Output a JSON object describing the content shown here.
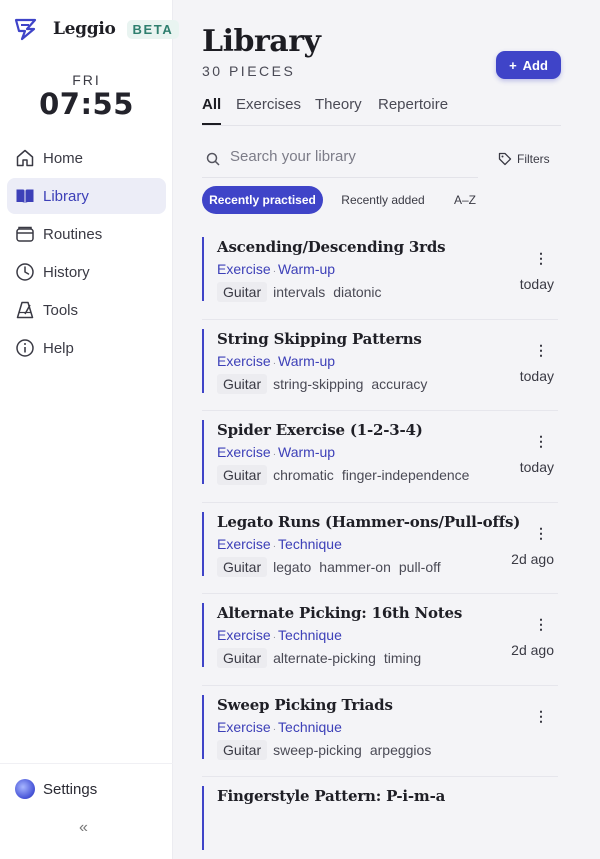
{
  "app": {
    "name": "Leggio",
    "badge": "BETA"
  },
  "clock": {
    "day": "FRI",
    "time": "07:55"
  },
  "nav": [
    {
      "label": "Home",
      "icon": "home-icon",
      "active": false
    },
    {
      "label": "Library",
      "icon": "book-icon",
      "active": true
    },
    {
      "label": "Routines",
      "icon": "folder-icon",
      "active": false
    },
    {
      "label": "History",
      "icon": "clock-icon",
      "active": false
    },
    {
      "label": "Tools",
      "icon": "metronome-icon",
      "active": false
    },
    {
      "label": "Help",
      "icon": "info-icon",
      "active": false
    }
  ],
  "settings": {
    "label": "Settings"
  },
  "library": {
    "title": "Library",
    "count": "30 PIECES",
    "add_label": "Add",
    "tabs": [
      "All",
      "Exercises",
      "Theory",
      "Repertoire"
    ],
    "search_placeholder": "Search your library",
    "filters_label": "Filters",
    "sort_options": [
      "Recently practised",
      "Recently added",
      "A–Z"
    ],
    "items": [
      {
        "title": "Ascending/Descending 3rds",
        "type": "Exercise",
        "category": "Warm-up",
        "instrument": "Guitar",
        "tags": [
          "intervals",
          "diatonic"
        ],
        "when": "today"
      },
      {
        "title": "String Skipping Patterns",
        "type": "Exercise",
        "category": "Warm-up",
        "instrument": "Guitar",
        "tags": [
          "string-skipping",
          "accuracy"
        ],
        "when": "today"
      },
      {
        "title": "Spider Exercise (1-2-3-4)",
        "type": "Exercise",
        "category": "Warm-up",
        "instrument": "Guitar",
        "tags": [
          "chromatic",
          "finger-independence"
        ],
        "when": "today"
      },
      {
        "title": "Legato Runs (Hammer-ons/Pull-offs)",
        "type": "Exercise",
        "category": "Technique",
        "instrument": "Guitar",
        "tags": [
          "legato",
          "hammer-on",
          "pull-off"
        ],
        "when": "2d ago"
      },
      {
        "title": "Alternate Picking: 16th Notes",
        "type": "Exercise",
        "category": "Technique",
        "instrument": "Guitar",
        "tags": [
          "alternate-picking",
          "timing"
        ],
        "when": "2d ago"
      },
      {
        "title": "Sweep Picking Triads",
        "type": "Exercise",
        "category": "Technique",
        "instrument": "Guitar",
        "tags": [
          "sweep-picking",
          "arpeggios"
        ],
        "when": ""
      },
      {
        "title": "Fingerstyle Pattern: P-i-m-a",
        "type": "",
        "category": "",
        "instrument": "",
        "tags": [],
        "when": ""
      }
    ]
  }
}
